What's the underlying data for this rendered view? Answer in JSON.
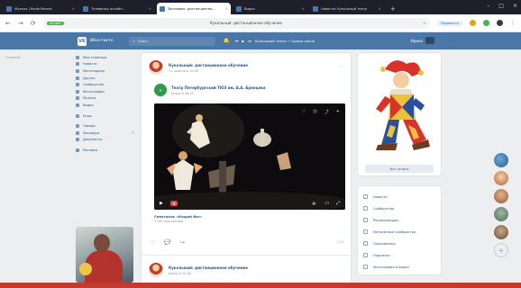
{
  "browser": {
    "tabs": [
      {
        "label": "Музыка | Radio Record"
      },
      {
        "label": "Телевизор онлайн..."
      },
      {
        "label": "Заголовок: дистанционно...",
        "active": true
      },
      {
        "label": "Видео"
      },
      {
        "label": "Новости! Кукольный театр"
      }
    ],
    "url_tag": "vk.com",
    "url_title": "Кукольный: дистанционное обучение",
    "translate_pill": "Перевести"
  },
  "vk": {
    "brand": "ВКонтакте",
    "search_placeholder": "Поиск",
    "player_text": "Кукольный театр • Сказки online",
    "user_name": "Ирина"
  },
  "left_ext": "Гелёный",
  "left_menu": [
    {
      "label": "Моя страница"
    },
    {
      "label": "Новости"
    },
    {
      "label": "Мессенджер"
    },
    {
      "label": "Друзья"
    },
    {
      "label": "Сообщества"
    },
    {
      "label": "Фотографии"
    },
    {
      "label": "Музыка"
    },
    {
      "label": "Видео"
    },
    {
      "label": "Игры",
      "sep": true
    },
    {
      "label": "Товары",
      "sep": true
    },
    {
      "label": "Закладки",
      "badge": "3"
    },
    {
      "label": "Документы"
    },
    {
      "label": "Реклама",
      "sep": true
    }
  ],
  "post": {
    "author": "Кукольный: дистанционное обучение",
    "time": "11 апреля в 10:00",
    "repost_author": "Театр Петербургский ТЮЗ им. А.А. Брянцева",
    "repost_time": "вчера в 16:41",
    "video_title": "Спектакль «Кащей Вот»",
    "video_sub": "1 240 просмотров",
    "views": "1,2К"
  },
  "post2": {
    "author": "Кукольный: дистанционное обучение",
    "time": "вчера в 12:00"
  },
  "right_card": {
    "button": "Все записи"
  },
  "right_menu": [
    {
      "label": "Новости"
    },
    {
      "label": "Сообщества"
    },
    {
      "label": "Рекомендации"
    },
    {
      "label": "Интересные сообщества"
    },
    {
      "label": "Понравилось"
    },
    {
      "label": "Подписки"
    },
    {
      "label": "Фотографии и видео"
    }
  ],
  "colors": {
    "vk_blue": "#4a76a8",
    "link": "#2a5885"
  }
}
